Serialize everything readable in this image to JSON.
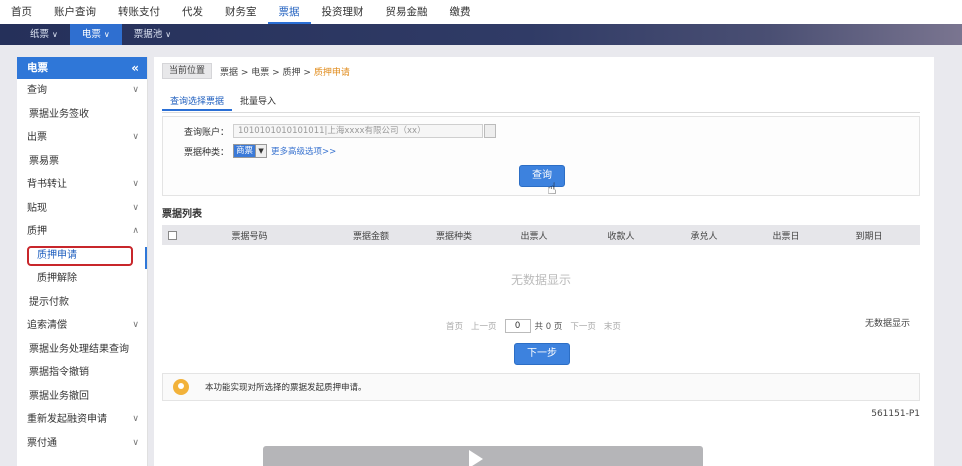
{
  "topnav": {
    "items": [
      "首页",
      "账户查询",
      "转账支付",
      "代发",
      "财务室",
      "票据",
      "投资理财",
      "贸易金融",
      "缴费"
    ],
    "active_index": 5
  },
  "subnav": {
    "items": [
      "纸票",
      "电票",
      "票据池"
    ],
    "active_index": 1
  },
  "sidebar": {
    "title": "电票",
    "collapse_icon": "«",
    "rows": [
      {
        "label": "查询",
        "type": "group"
      },
      {
        "label": "票据业务签收",
        "type": "child"
      },
      {
        "label": "出票",
        "type": "group"
      },
      {
        "label": "票易票",
        "type": "child"
      },
      {
        "label": "背书转让",
        "type": "group"
      },
      {
        "label": "贴现",
        "type": "group"
      },
      {
        "label": "质押",
        "type": "group"
      },
      {
        "label": "质押申请",
        "type": "selected"
      },
      {
        "label": "质押解除",
        "type": "sub"
      },
      {
        "label": "提示付款",
        "type": "plain"
      },
      {
        "label": "追索清偿",
        "type": "group"
      },
      {
        "label": "票据业务处理结果查询",
        "type": "plain"
      },
      {
        "label": "票据指令撤销",
        "type": "plain"
      },
      {
        "label": "票据业务撤回",
        "type": "plain"
      },
      {
        "label": "重新发起融资申请",
        "type": "group"
      },
      {
        "label": "票付通",
        "type": "group"
      }
    ]
  },
  "breadcrumb": {
    "position_label": "当前位置",
    "path": "票据 > 电票 > 质押 > ",
    "current": "质押申请"
  },
  "tabs": [
    "查询选择票据",
    "批量导入"
  ],
  "form": {
    "account_label": "查询账户：",
    "account_value": "1010101010101011|上海xxxx有限公司（xx）",
    "type_label": "票据种类：",
    "type_value": "商票",
    "more_options": "更多高级选项>>",
    "query_button": "查询"
  },
  "list": {
    "title": "票据列表",
    "columns": [
      "票据号码",
      "票据金额",
      "票据种类",
      "出票人",
      "收款人",
      "承兑人",
      "出票日",
      "到期日"
    ],
    "empty_text": "无数据显示"
  },
  "pager": {
    "first": "首页",
    "prev": "上一页",
    "page_value": "0",
    "total": "共 0 页",
    "next": "下一页",
    "last": "末页",
    "right_text": "无数据显示"
  },
  "next_button": "下一步",
  "tip_text": "本功能实现对所选择的票据发起质押申请。",
  "page_code": "561151-P1"
}
